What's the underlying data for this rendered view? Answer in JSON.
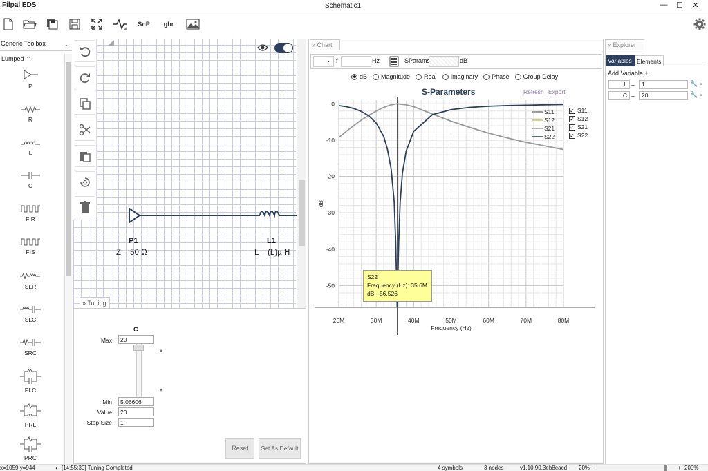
{
  "app_title": "Filpal EDS",
  "doc_title": "Schematic1",
  "window_controls": [
    "—",
    "☐",
    "✕"
  ],
  "toolbar": {
    "snp_label": "SnP",
    "gbr_label": "gbr"
  },
  "sidebar": {
    "toolbox_select": "Generic Toolbox",
    "category": "Lumped ⌃",
    "components": [
      "P",
      "R",
      "L",
      "C",
      "FIR",
      "FIS",
      "SLR",
      "SLC",
      "SRC",
      "PLC",
      "PRL",
      "PRC"
    ]
  },
  "schematic": {
    "p1_name": "P1",
    "p1_value": "Z = 50 Ω",
    "l1_name": "L1",
    "l1_value": "L = (L)µ H"
  },
  "tuning": {
    "tab_label": "Tuning",
    "variable": "C",
    "max_label": "Max",
    "max_value": "20",
    "min_label": "Min",
    "min_value": "5.06606",
    "value_label": "Value",
    "value_value": "20",
    "step_label": "Step Size",
    "step_value": "1",
    "reset_label": "Reset",
    "default_label": "Set As Default"
  },
  "chart_panel": {
    "tab_label": "Chart",
    "f_label": "f",
    "hz_label": "Hz",
    "sparams_label": "SParams",
    "db_label": "dB",
    "modes": [
      "dB",
      "Magnitude",
      "Real",
      "Imaginary",
      "Phase",
      "Group Delay"
    ],
    "selected_mode": "dB",
    "refresh_label": "Refresh",
    "export_label": "Export"
  },
  "chart_data": {
    "type": "line",
    "title": "S-Parameters",
    "xlabel": "Frequency (Hz)",
    "ylabel": "dB",
    "xlim": [
      20,
      80
    ],
    "ylim": [
      -56,
      1
    ],
    "x_ticks": [
      "20M",
      "30M",
      "40M",
      "50M",
      "60M",
      "70M",
      "80M"
    ],
    "y_ticks": [
      "0",
      "-10",
      "-20",
      "-30",
      "-40",
      "-50"
    ],
    "legend": [
      "S11",
      "S12",
      "S21",
      "S22"
    ],
    "series": [
      {
        "name": "S11",
        "color": "#7f7f7f",
        "x": [
          20,
          22,
          24,
          26,
          28,
          30,
          32,
          34,
          35.6,
          38,
          40,
          45,
          50,
          55,
          60,
          65,
          70,
          75,
          80
        ],
        "y": [
          -9.3,
          -7.6,
          -6.0,
          -4.5,
          -3.2,
          -2.0,
          -1.0,
          -0.3,
          0,
          -0.3,
          -0.8,
          -2.8,
          -4.8,
          -6.5,
          -8.1,
          -9.4,
          -10.6,
          -11.6,
          -12.6
        ]
      },
      {
        "name": "S12",
        "color": "#c8c050",
        "x": [
          20,
          22,
          24,
          26,
          28,
          30,
          32,
          33,
          34,
          34.8,
          35.2,
          35.6,
          36,
          36.4,
          37,
          38,
          40,
          45,
          50,
          55,
          60,
          65,
          70,
          75,
          80
        ],
        "y": [
          -0.5,
          -0.8,
          -1.3,
          -2.1,
          -3.3,
          -5.3,
          -9,
          -12.5,
          -18,
          -27,
          -38,
          -56.5,
          -38,
          -27,
          -19,
          -13,
          -7.6,
          -3.0,
          -1.6,
          -1.0,
          -0.7,
          -0.5,
          -0.4,
          -0.3,
          -0.2
        ]
      },
      {
        "name": "S21",
        "color": "#9a9a9a",
        "x": [
          20,
          22,
          24,
          26,
          28,
          30,
          32,
          34,
          35.6,
          38,
          40,
          45,
          50,
          55,
          60,
          65,
          70,
          75,
          80
        ],
        "y": [
          -9.3,
          -7.6,
          -6.0,
          -4.5,
          -3.2,
          -2.0,
          -1.0,
          -0.3,
          0,
          -0.3,
          -0.8,
          -2.8,
          -4.8,
          -6.5,
          -8.1,
          -9.4,
          -10.6,
          -11.6,
          -12.6
        ]
      },
      {
        "name": "S22",
        "color": "#2d3f5e",
        "x": [
          20,
          22,
          24,
          26,
          28,
          30,
          32,
          33,
          34,
          34.8,
          35.2,
          35.6,
          36,
          36.4,
          37,
          38,
          40,
          45,
          50,
          55,
          60,
          65,
          70,
          75,
          80
        ],
        "y": [
          -0.5,
          -0.8,
          -1.3,
          -2.1,
          -3.3,
          -5.3,
          -9,
          -12.5,
          -18,
          -27,
          -38,
          -56.5,
          -38,
          -27,
          -19,
          -13,
          -7.6,
          -3.0,
          -1.6,
          -1.0,
          -0.7,
          -0.5,
          -0.4,
          -0.3,
          -0.2
        ]
      }
    ],
    "tooltip": {
      "series": "S22",
      "line1": "Frequency (Hz): 35.6M",
      "line2": "dB: -56.526"
    }
  },
  "explorer": {
    "tab_label": "Explorer",
    "tabs": [
      "Variables",
      "Elements"
    ],
    "add_label": "Add Variable  +",
    "vars": [
      {
        "name": "L",
        "value": "1"
      },
      {
        "name": "C",
        "value": "20"
      }
    ]
  },
  "status": {
    "coords": "x=1059 y=944",
    "log": "[14:55:30] Tuning  Completed",
    "symbols": "4 symbols",
    "nodes": "3 nodes",
    "version": "v1.10.90.3eb8eacd",
    "zoom_min": "20%",
    "zoom_max": "200%"
  }
}
